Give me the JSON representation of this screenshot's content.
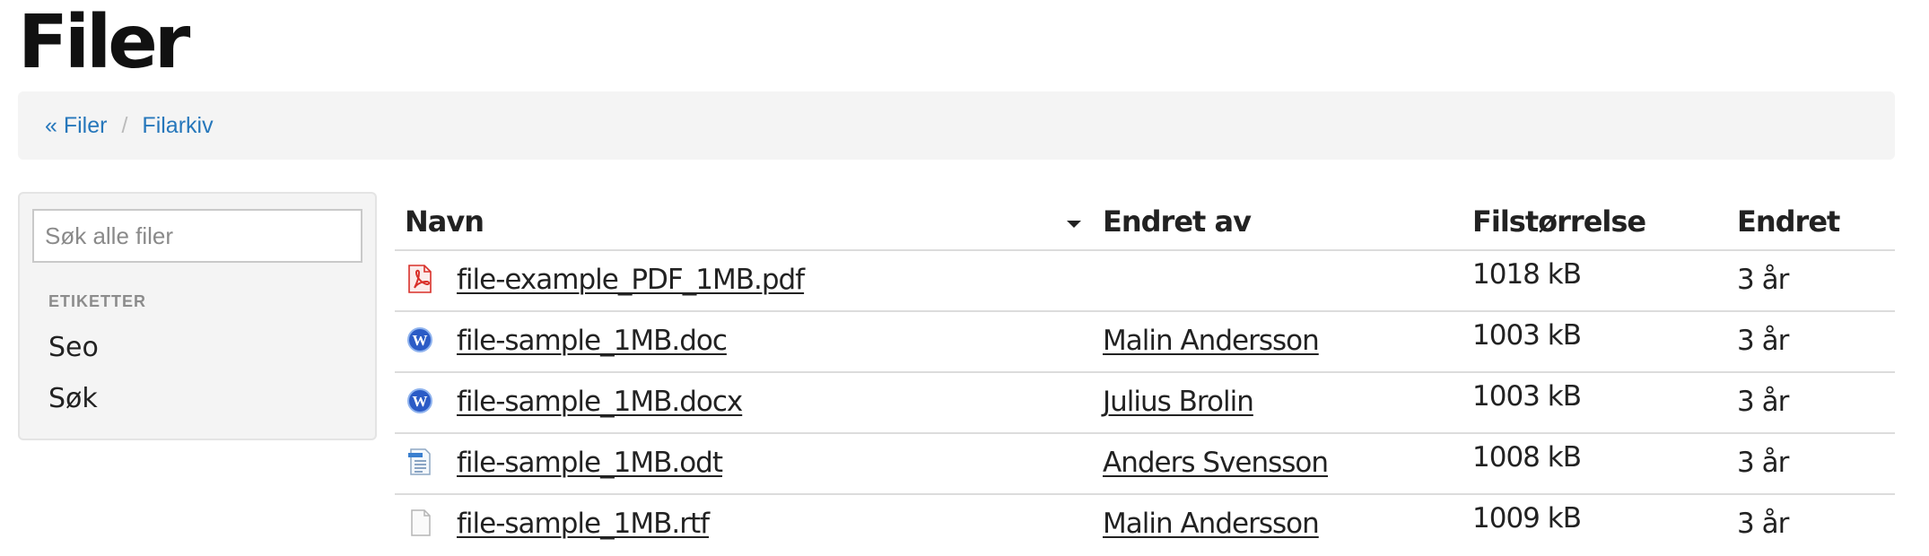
{
  "page": {
    "title": "Filer"
  },
  "breadcrumb": {
    "items": [
      {
        "label": "« Filer"
      },
      {
        "label": "Filarkiv"
      }
    ],
    "separator": "/"
  },
  "sidebar": {
    "search": {
      "placeholder": "Søk alle filer",
      "value": ""
    },
    "tags_heading": "ETIKETTER",
    "tags": [
      {
        "label": "Seo"
      },
      {
        "label": "Søk"
      }
    ]
  },
  "table": {
    "columns": {
      "name": "Navn",
      "modified_by": "Endret av",
      "size": "Filstørrelse",
      "modified": "Endret"
    },
    "sort_indicator": "chevron-down-icon",
    "rows": [
      {
        "name": "file-example_PDF_1MB.pdf",
        "modified_by": "",
        "size": "1018 kB",
        "modified": "3 år",
        "icon": "pdf-file-icon"
      },
      {
        "name": "file-sample_1MB.doc",
        "modified_by": "Malin Andersson",
        "size": "1003 kB",
        "modified": "3 år",
        "icon": "word-file-icon"
      },
      {
        "name": "file-sample_1MB.docx",
        "modified_by": "Julius Brolin",
        "size": "1003 kB",
        "modified": "3 år",
        "icon": "word-file-icon"
      },
      {
        "name": "file-sample_1MB.odt",
        "modified_by": "Anders Svensson",
        "size": "1008 kB",
        "modified": "3 år",
        "icon": "odt-file-icon"
      },
      {
        "name": "file-sample_1MB.rtf",
        "modified_by": "Malin Andersson",
        "size": "1009 kB",
        "modified": "3 år",
        "icon": "generic-file-icon"
      }
    ]
  },
  "colors": {
    "link": "#2677bb",
    "panel_bg": "#f4f4f4",
    "text": "#222222",
    "muted": "#8c8c8c",
    "pdf_red": "#d9302a",
    "word_blue": "#2b5bc6"
  }
}
